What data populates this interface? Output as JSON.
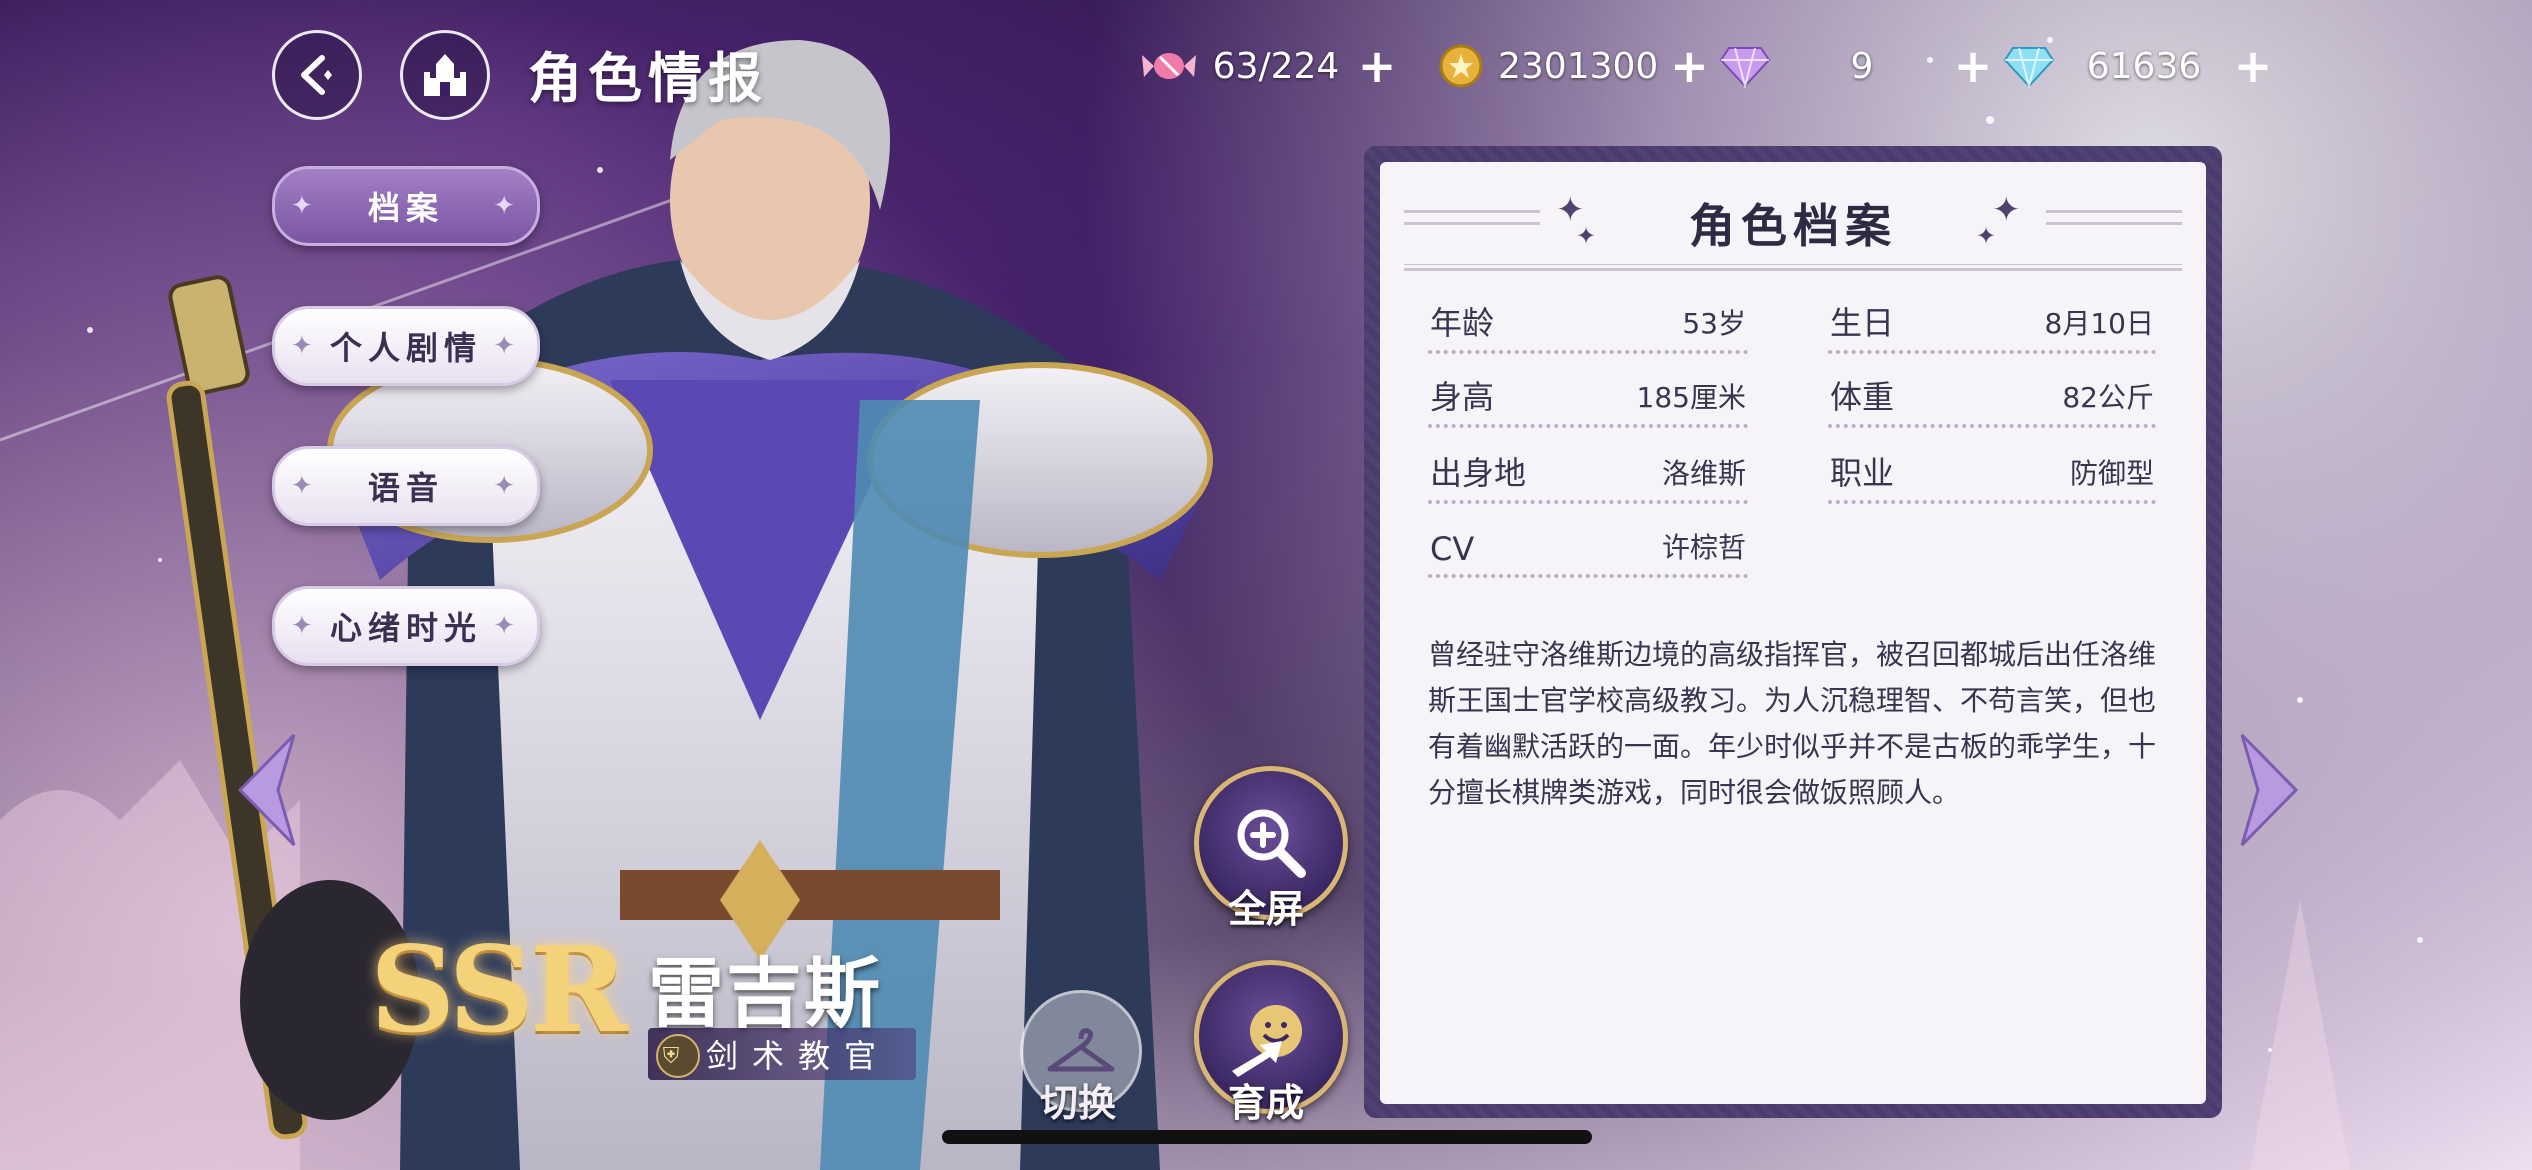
{
  "header": {
    "title": "角色情报",
    "back_icon": "back-arrow-icon",
    "home_icon": "castle-icon"
  },
  "currencies": [
    {
      "icon": "candy-icon",
      "value": "63/224"
    },
    {
      "icon": "gold-coin-icon",
      "value": "2301300"
    },
    {
      "icon": "purple-gem-icon",
      "value": "9"
    },
    {
      "icon": "blue-diamond-icon",
      "value": "61636"
    }
  ],
  "menu": {
    "items": [
      {
        "label": "档案",
        "active": true
      },
      {
        "label": "个人剧情",
        "active": false
      },
      {
        "label": "语音",
        "active": false
      },
      {
        "label": "心绪时光",
        "active": false
      }
    ]
  },
  "character": {
    "rarity": "SSR",
    "name": "雷吉斯",
    "title": "剑术教官"
  },
  "actions": {
    "fullscreen_label": "全屏",
    "train_label": "育成",
    "switch_label": "切换"
  },
  "profile": {
    "title": "角色档案",
    "fields": {
      "age": {
        "key": "年龄",
        "value": "53岁"
      },
      "birthday": {
        "key": "生日",
        "value": "8月10日"
      },
      "height": {
        "key": "身高",
        "value": "185厘米"
      },
      "weight": {
        "key": "体重",
        "value": "82公斤"
      },
      "origin": {
        "key": "出身地",
        "value": "洛维斯"
      },
      "job": {
        "key": "职业",
        "value": "防御型"
      },
      "cv": {
        "key": "CV",
        "value": "许棕哲"
      }
    },
    "description": "曾经驻守洛维斯边境的高级指挥官，被召回都城后出任洛维斯王国士官学校高级教习。为人沉稳理智、不苟言笑，但也有着幽默活跃的一面。年少时似乎并不是古板的乖学生，十分擅长棋牌类游戏，同时很会做饭照顾人。"
  },
  "colors": {
    "panel_frame": "#4a3a6e",
    "panel_bg": "#f6f4f8",
    "gold_accent": "#d9b673",
    "menu_active": "#8b66b3"
  }
}
